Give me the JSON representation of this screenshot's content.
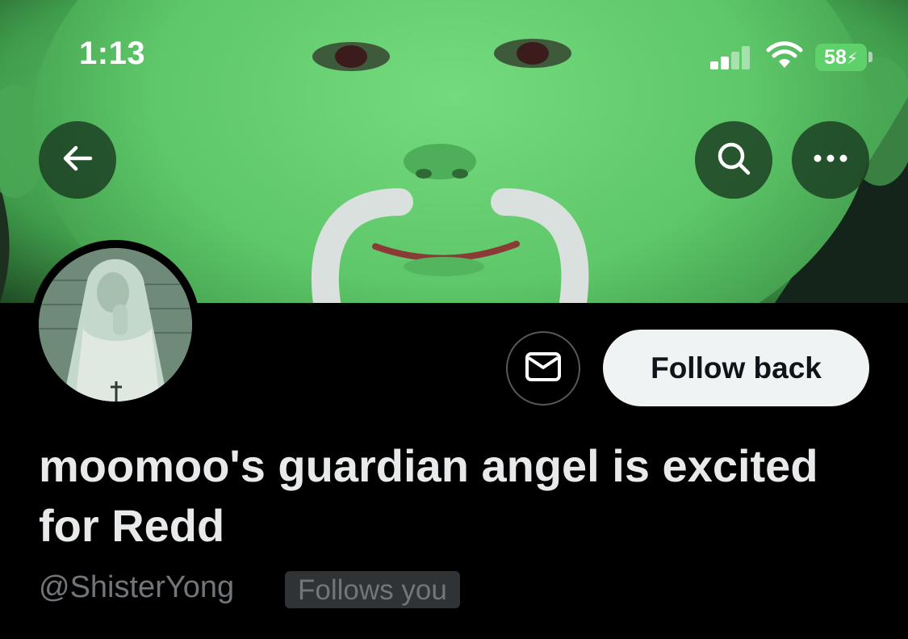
{
  "status_bar": {
    "time": "1:13",
    "battery": "58",
    "battery_color": "#5fd16b"
  },
  "nav": {
    "back_icon": "arrow-left-icon",
    "search_icon": "search-icon",
    "more_icon": "more-horizontal-icon"
  },
  "profile": {
    "display_name": "moomoo's guardian angel is excited for Redd",
    "handle": "@ShisterYong",
    "follows_you_label": "Follows you",
    "follow_button_label": "Follow back",
    "message_icon": "envelope-icon"
  },
  "colors": {
    "background": "#000000",
    "name_text": "#e7e9ea",
    "secondary_text": "#71767b",
    "follow_button_bg": "#eff3f4",
    "banner_green": "#5cc267"
  }
}
